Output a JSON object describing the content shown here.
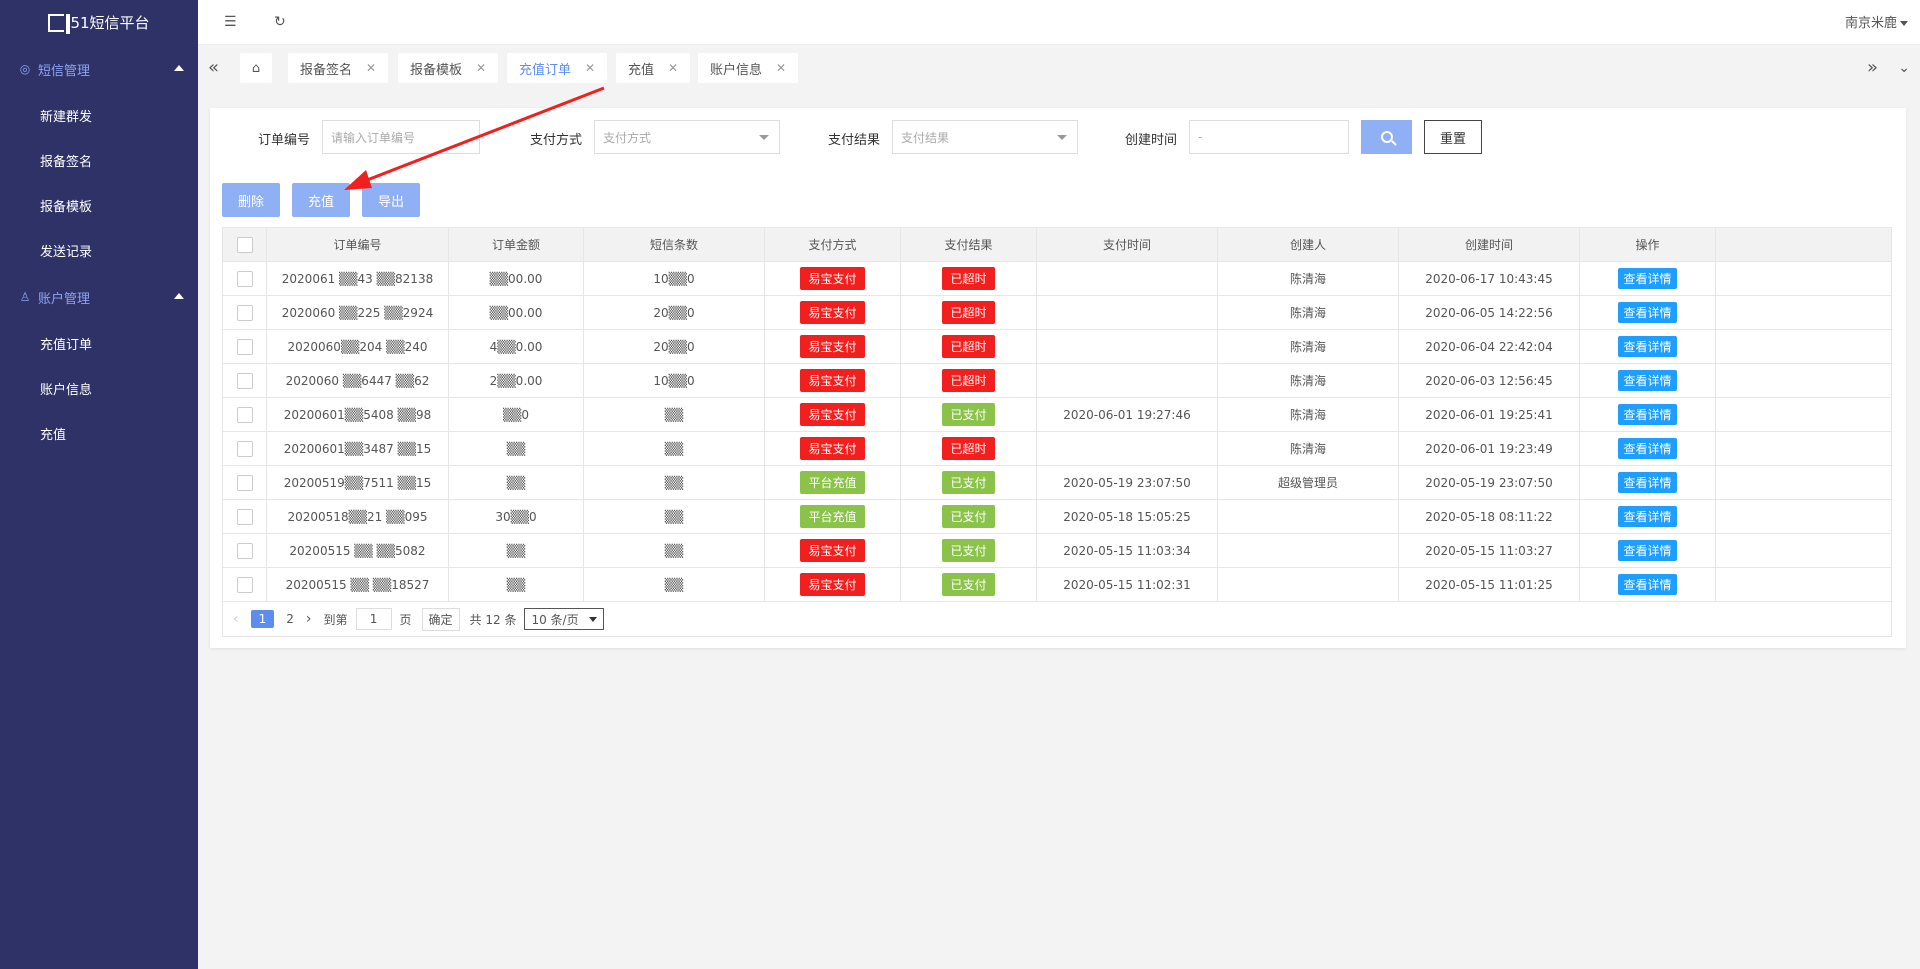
{
  "app": {
    "title": "51短信平台"
  },
  "sidebar": {
    "groups": [
      {
        "label": "短信管理",
        "items": [
          "新建群发",
          "报备签名",
          "报备模板",
          "发送记录"
        ]
      },
      {
        "label": "账户管理",
        "items": [
          "充值订单",
          "账户信息",
          "充值"
        ]
      }
    ]
  },
  "header": {
    "user": "南京米鹿"
  },
  "tabs": [
    {
      "label": "报备签名",
      "active": false
    },
    {
      "label": "报备模板",
      "active": false
    },
    {
      "label": "充值订单",
      "active": true
    },
    {
      "label": "充值",
      "active": false
    },
    {
      "label": "账户信息",
      "active": false
    }
  ],
  "search": {
    "order_no_label": "订单编号",
    "order_no_placeholder": "请输入订单编号",
    "pay_method_label": "支付方式",
    "pay_method_placeholder": "支付方式",
    "pay_result_label": "支付结果",
    "pay_result_placeholder": "支付结果",
    "created_label": "创建时间",
    "created_placeholder": "-",
    "reset_label": "重置"
  },
  "toolbar": {
    "delete_label": "删除",
    "recharge_label": "充值",
    "export_label": "导出"
  },
  "table": {
    "headers": [
      "订单编号",
      "订单金额",
      "短信条数",
      "支付方式",
      "支付结果",
      "支付时间",
      "创建人",
      "创建时间",
      "操作"
    ],
    "rows": [
      {
        "order": "2020061 ▒▒43 ▒▒82138",
        "amount": "▒▒00.00",
        "count": "10▒▒0",
        "method": "易宝支付",
        "method_color": "red",
        "result": "已超时",
        "result_color": "red",
        "paid_at": "",
        "creator": "陈清海",
        "created_at": "2020-06-17 10:43:45",
        "action": "查看详情"
      },
      {
        "order": "2020060 ▒▒225 ▒▒2924",
        "amount": "▒▒00.00",
        "count": "20▒▒0",
        "method": "易宝支付",
        "method_color": "red",
        "result": "已超时",
        "result_color": "red",
        "paid_at": "",
        "creator": "陈清海",
        "created_at": "2020-06-05 14:22:56",
        "action": "查看详情"
      },
      {
        "order": "2020060▒▒204 ▒▒240",
        "amount": "4▒▒0.00",
        "count": "20▒▒0",
        "method": "易宝支付",
        "method_color": "red",
        "result": "已超时",
        "result_color": "red",
        "paid_at": "",
        "creator": "陈清海",
        "created_at": "2020-06-04 22:42:04",
        "action": "查看详情"
      },
      {
        "order": "2020060 ▒▒6447 ▒▒62",
        "amount": "2▒▒0.00",
        "count": "10▒▒0",
        "method": "易宝支付",
        "method_color": "red",
        "result": "已超时",
        "result_color": "red",
        "paid_at": "",
        "creator": "陈清海",
        "created_at": "2020-06-03 12:56:45",
        "action": "查看详情"
      },
      {
        "order": "20200601▒▒5408 ▒▒98",
        "amount": "▒▒0",
        "count": "▒▒",
        "method": "易宝支付",
        "method_color": "red",
        "result": "已支付",
        "result_color": "green",
        "paid_at": "2020-06-01 19:27:46",
        "creator": "陈清海",
        "created_at": "2020-06-01 19:25:41",
        "action": "查看详情"
      },
      {
        "order": "20200601▒▒3487 ▒▒15",
        "amount": "▒▒",
        "count": "▒▒",
        "method": "易宝支付",
        "method_color": "red",
        "result": "已超时",
        "result_color": "red",
        "paid_at": "",
        "creator": "陈清海",
        "created_at": "2020-06-01 19:23:49",
        "action": "查看详情"
      },
      {
        "order": "20200519▒▒7511 ▒▒15",
        "amount": "▒▒",
        "count": "▒▒",
        "method": "平台充值",
        "method_color": "green",
        "result": "已支付",
        "result_color": "green",
        "paid_at": "2020-05-19 23:07:50",
        "creator": "超级管理员",
        "created_at": "2020-05-19 23:07:50",
        "action": "查看详情"
      },
      {
        "order": "20200518▒▒21 ▒▒095",
        "amount": "30▒▒0",
        "count": "▒▒",
        "method": "平台充值",
        "method_color": "green",
        "result": "已支付",
        "result_color": "green",
        "paid_at": "2020-05-18 15:05:25",
        "creator": "",
        "created_at": "2020-05-18 08:11:22",
        "action": "查看详情"
      },
      {
        "order": "20200515 ▒▒ ▒▒5082",
        "amount": "▒▒",
        "count": "▒▒",
        "method": "易宝支付",
        "method_color": "red",
        "result": "已支付",
        "result_color": "green",
        "paid_at": "2020-05-15 11:03:34",
        "creator": "",
        "created_at": "2020-05-15 11:03:27",
        "action": "查看详情"
      },
      {
        "order": "20200515 ▒▒ ▒▒18527",
        "amount": "▒▒",
        "count": "▒▒",
        "method": "易宝支付",
        "method_color": "red",
        "result": "已支付",
        "result_color": "green",
        "paid_at": "2020-05-15 11:02:31",
        "creator": "",
        "created_at": "2020-05-15 11:01:25",
        "action": "查看详情"
      }
    ]
  },
  "pager": {
    "pages": [
      "1",
      "2"
    ],
    "current": "1",
    "goto_label": "到第",
    "goto_value": "1",
    "page_unit": "页",
    "confirm_label": "确定",
    "total_label": "共 12 条",
    "page_size": "10 条/页"
  },
  "colors": {
    "sidebar_bg": "#2e3267",
    "accent": "#5b8ef0",
    "button": "#8fb0f5",
    "danger": "#f21f1f",
    "success": "#8bc34a",
    "link_btn": "#1e9fff"
  }
}
